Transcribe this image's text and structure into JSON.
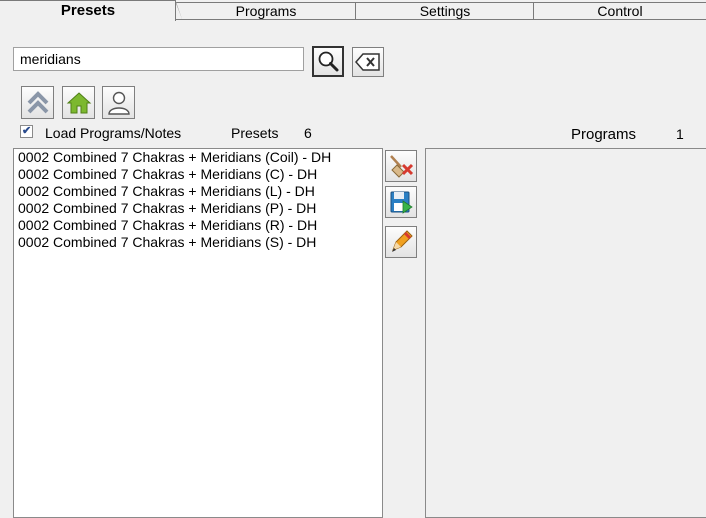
{
  "tabs": [
    {
      "label": "Presets",
      "active": true
    },
    {
      "label": "Programs",
      "active": false
    },
    {
      "label": "Settings",
      "active": false
    },
    {
      "label": "Control",
      "active": false
    }
  ],
  "search": {
    "value": "meridians",
    "placeholder": ""
  },
  "load_programs": {
    "label": "Load Programs/Notes",
    "checked": true
  },
  "presets": {
    "label": "Presets",
    "count": "6"
  },
  "programs": {
    "label": "Programs",
    "count": "1"
  },
  "preset_items": [
    "0002 Combined 7 Chakras + Meridians (Coil) - DH",
    "0002 Combined 7 Chakras + Meridians (C) - DH",
    "0002 Combined 7 Chakras + Meridians (L) - DH",
    "0002 Combined 7 Chakras + Meridians (P) - DH",
    "0002 Combined 7 Chakras + Meridians (R) - DH",
    "0002 Combined 7 Chakras + Meridians (S) - DH"
  ],
  "icons": {
    "search": "magnifier-icon",
    "clear": "backspace-icon",
    "up": "double-chevron-up-icon",
    "home": "home-icon",
    "user": "user-icon",
    "delete": "broom-delete-icon",
    "save": "save-icon",
    "edit": "pencil-icon"
  },
  "colors": {
    "home": "#7cb82f",
    "delete": "#d63a2f",
    "save": "#2a7fc4",
    "edit": "#f0a020"
  }
}
